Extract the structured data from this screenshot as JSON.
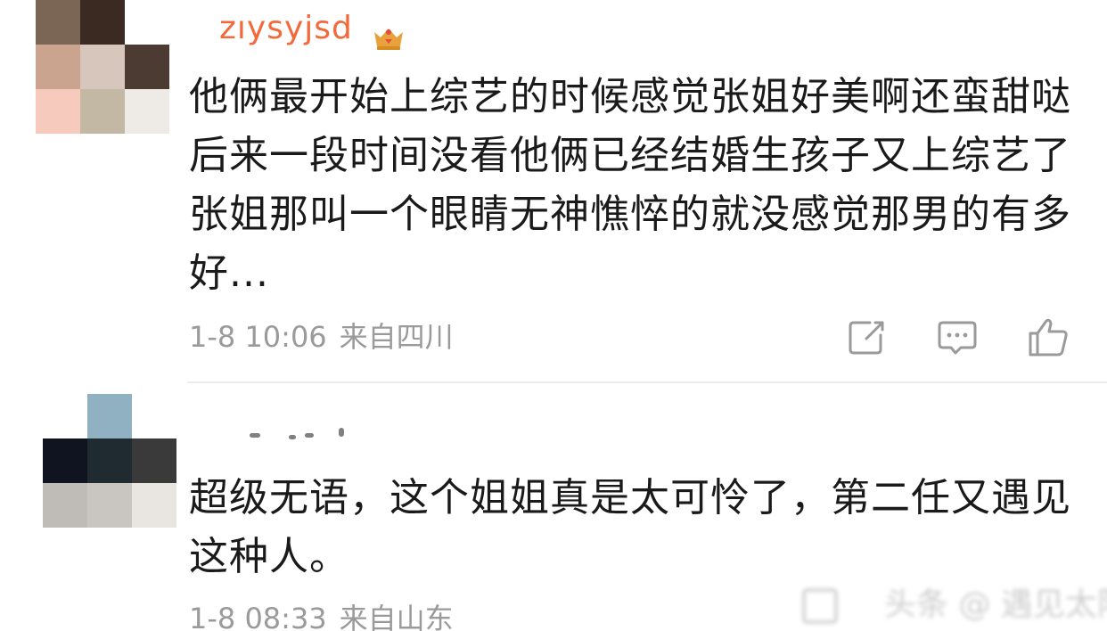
{
  "comments": [
    {
      "username": "zıysyjsd",
      "text": "他俩最开始上综艺的时候感觉张姐好美啊还蛮甜哒 后来一段时间没看他俩已经结婚生孩子又上综艺了 张姐那叫一个眼睛无神憔悴的就没感觉那男的有多好...",
      "time": "1-8 10:06",
      "location": "来自四川",
      "avatar_colors": [
        "#7b6555",
        "#3a2a22",
        "#ffffff",
        "#caa48f",
        "#d7c6bc",
        "#4b3b33",
        "#f6cbbd",
        "#c2b8a3",
        "#eeeae6"
      ],
      "actions": {
        "share_icon": "share-icon",
        "reply_icon": "comment-icon",
        "like_icon": "thumbs-up-icon"
      },
      "badge_color": "#e9a23b",
      "username_color": "#f26a3c"
    },
    {
      "text": "超级无语，这个姐姐真是太可怜了，第二任又遇见这种人。",
      "time": "1-8 08:33",
      "location": "来自山东",
      "avatar_colors": [
        "#ffffff",
        "#8fb1c2",
        "#ffffff",
        "#0f1420",
        "#1f2a31",
        "#3a3a3a",
        "#bfbcb7",
        "#c9c6c2",
        "#e9e6e2"
      ]
    }
  ],
  "watermark": {
    "icon": "watermark-logo-icon",
    "text": "头条 @ 遇见太阳"
  },
  "colors": {
    "text": "#1a1a1a",
    "meta": "#9a9a9a",
    "divider": "#ececec"
  }
}
